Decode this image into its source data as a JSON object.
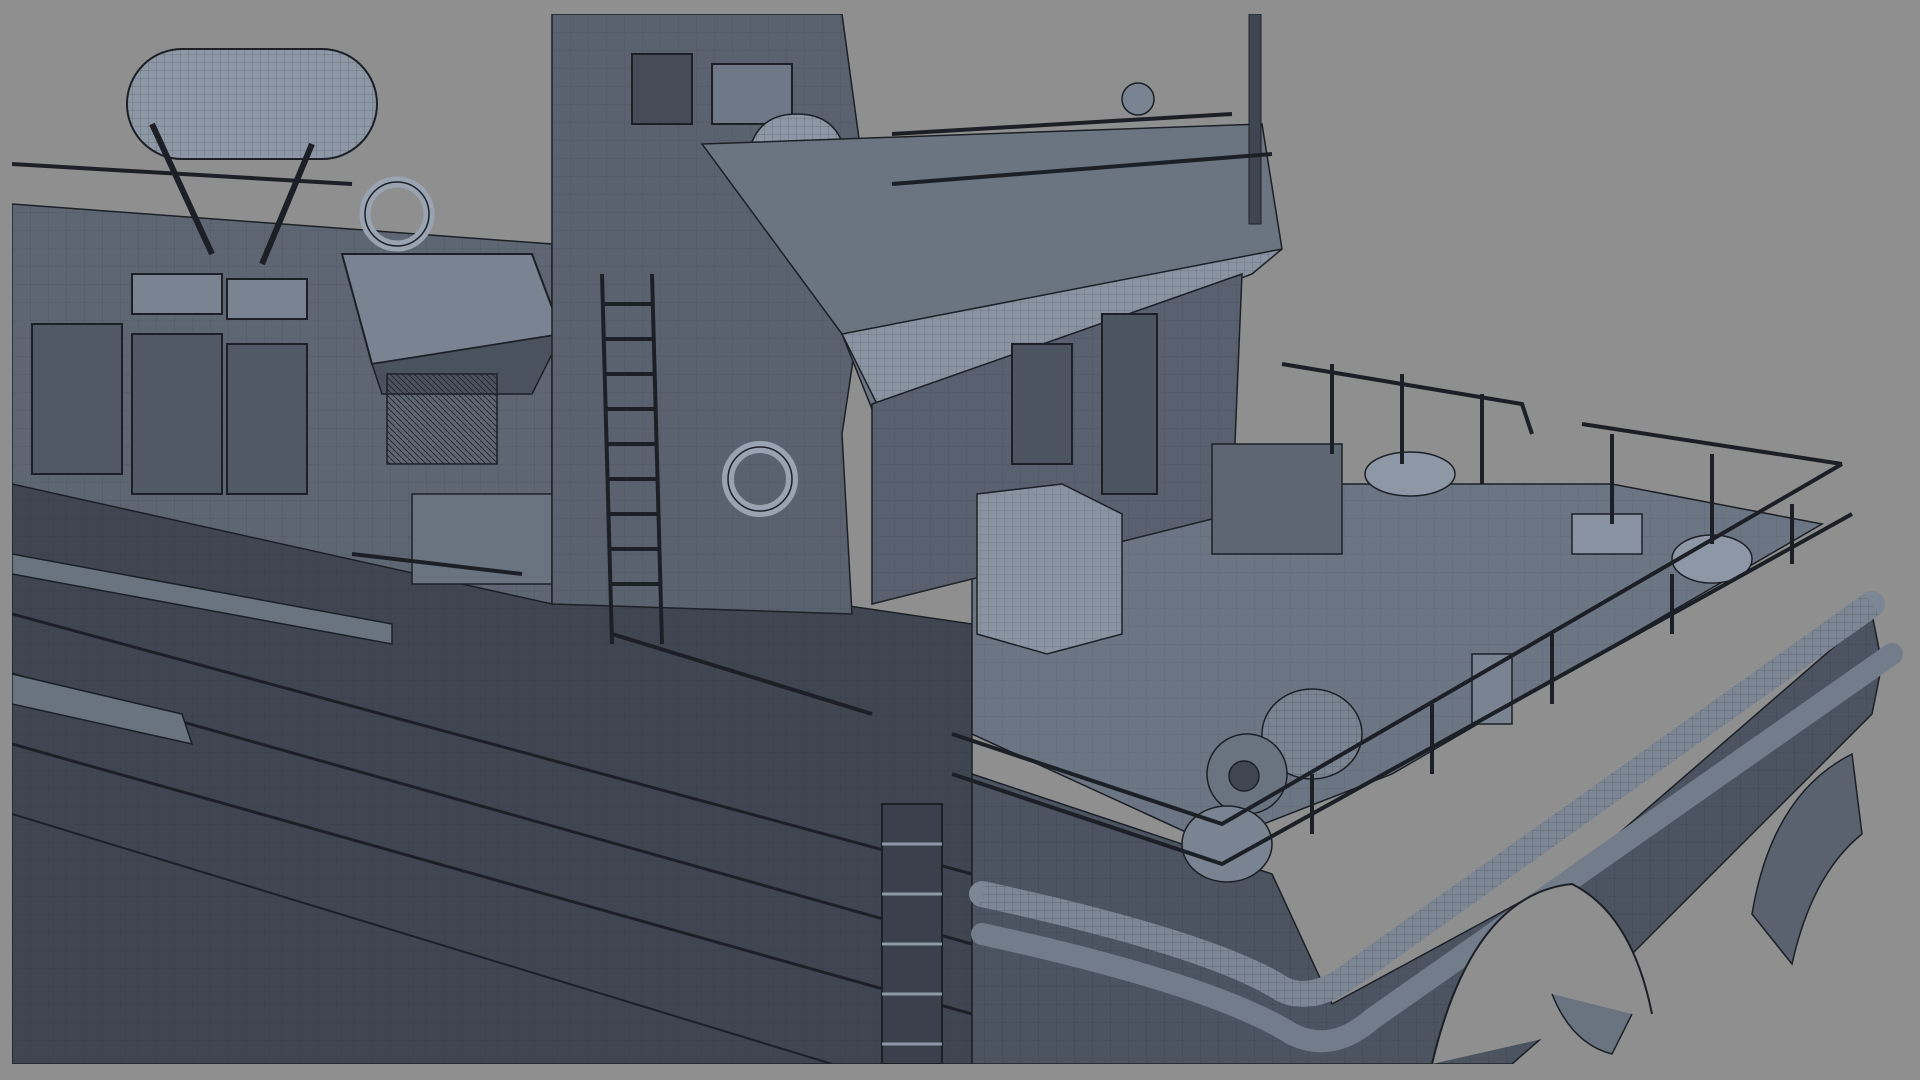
{
  "scene": {
    "kind": "3d-wireframe-render",
    "subject": "ship-aft-deck-model",
    "colors": {
      "background": "#8f8f8f",
      "hull_dark": "#3f4652",
      "hull_mid": "#545c69",
      "deck": "#6c7583",
      "superstructure": "#5e6674",
      "highlight": "#8e97a5",
      "edges": "#1c2026"
    }
  }
}
